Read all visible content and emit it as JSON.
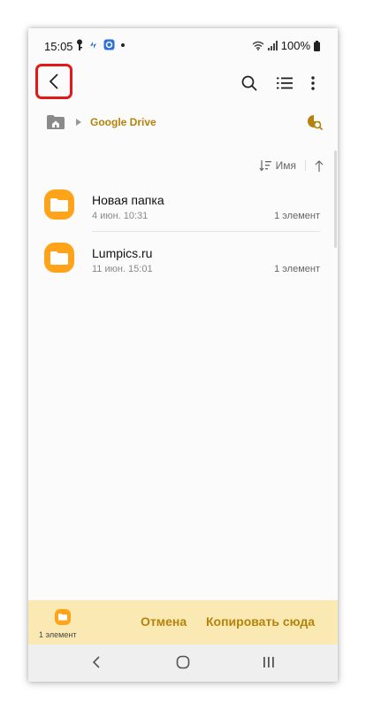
{
  "status": {
    "time": "15:05",
    "battery": "100%"
  },
  "breadcrumb": {
    "location": "Google Drive"
  },
  "sort": {
    "label": "Имя"
  },
  "files": [
    {
      "name": "Новая папка",
      "date": "4 июн. 10:31",
      "count": "1 элемент"
    },
    {
      "name": "Lumpics.ru",
      "date": "11 июн. 15:01",
      "count": "1 элемент"
    }
  ],
  "action": {
    "selected": "1 элемент",
    "cancel": "Отмена",
    "copy": "Копировать сюда"
  },
  "colors": {
    "accent": "#b5830b",
    "folder": "#ffa31a",
    "highlight": "#e11919",
    "actionbar": "#fbe9b3"
  }
}
